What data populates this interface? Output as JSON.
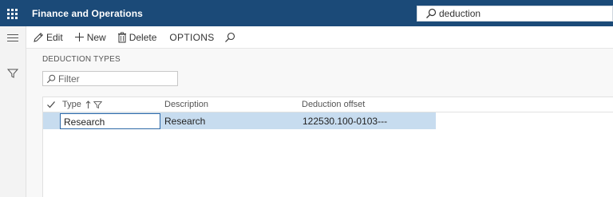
{
  "topbar": {
    "app_title": "Finance and Operations",
    "search_value": "deduction",
    "background_color": "#1b4a78"
  },
  "actions": {
    "edit": "Edit",
    "new": "New",
    "delete": "Delete",
    "options": "OPTIONS"
  },
  "page": {
    "section_title": "DEDUCTION TYPES",
    "filter_placeholder": "Filter"
  },
  "grid": {
    "columns": [
      "Type",
      "Description",
      "Deduction offset"
    ],
    "rows": [
      {
        "type": "Research",
        "description": "Research",
        "deduction_offset": "122530.100-0103---"
      }
    ],
    "selected_row_color": "#c7dcef"
  },
  "icons": {
    "waffle": "app-launcher-icon",
    "hamburger": "navigation-menu-icon",
    "filter_rail": "filter-pane-icon",
    "edit": "pencil-icon",
    "new": "plus-icon",
    "delete": "trash-icon",
    "search": "search-icon"
  }
}
